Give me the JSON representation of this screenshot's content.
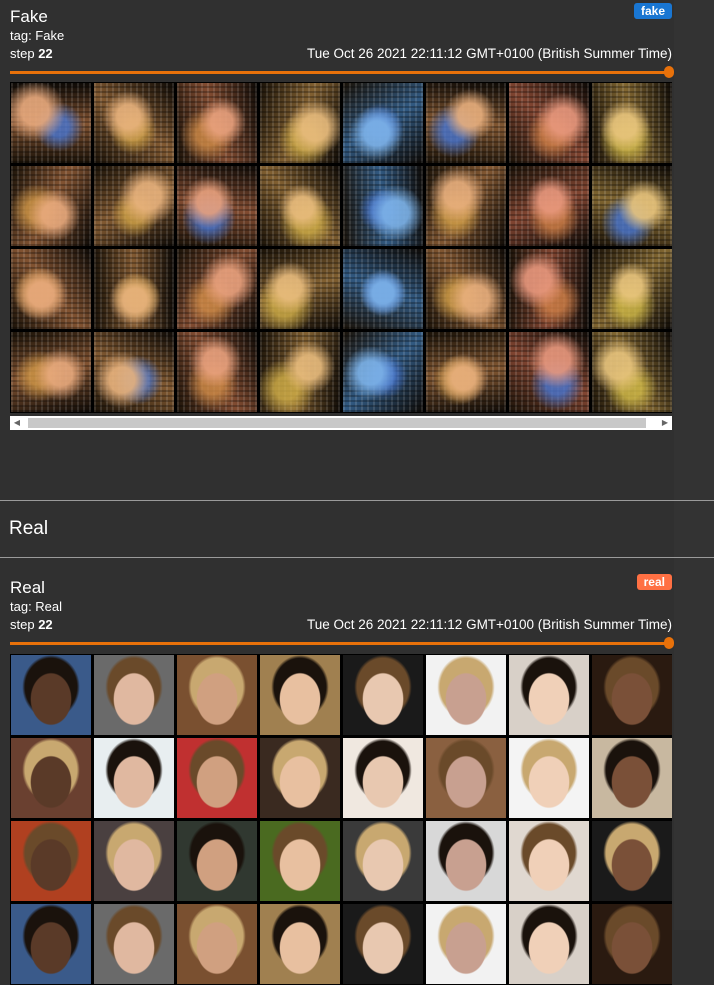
{
  "fake_card": {
    "title": "Fake",
    "badge": "fake",
    "badge_color": "#1976d2",
    "tag": "tag: Fake",
    "step_label": "step",
    "step_value": "22",
    "timestamp": "Tue Oct 26 2021 22:11:12 GMT+0100 (British Summer Time)",
    "slider_value": 1.0
  },
  "section": {
    "title": "Real"
  },
  "real_card": {
    "title": "Real",
    "badge": "real",
    "badge_color": "#ff7043",
    "tag": "tag: Real",
    "step_label": "step",
    "step_value": "22",
    "timestamp": "Tue Oct 26 2021 22:11:12 GMT+0100 (British Summer Time)",
    "slider_value": 1.0
  },
  "accent_color": "#e8710a"
}
